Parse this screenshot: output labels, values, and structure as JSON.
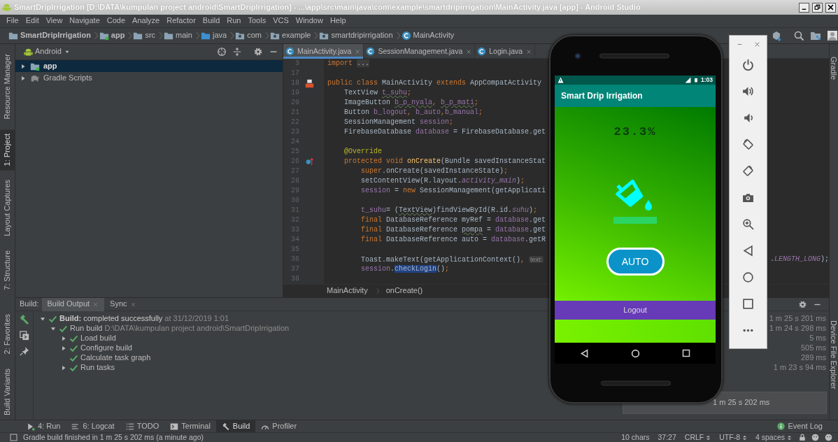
{
  "window": {
    "title": "SmartDripIrrigation [D:\\DATA\\kumpulan project android\\SmartDripIrrigation] - ...\\app\\src\\main\\java\\com\\example\\smartdripirrigation\\MainActivity.java [app] - Android Studio"
  },
  "menu": [
    "File",
    "Edit",
    "View",
    "Navigate",
    "Code",
    "Analyze",
    "Refactor",
    "Build",
    "Run",
    "Tools",
    "VCS",
    "Window",
    "Help"
  ],
  "breadcrumb": [
    {
      "label": "SmartDripIrrigation",
      "kind": "project"
    },
    {
      "label": "app",
      "kind": "module"
    },
    {
      "label": "src",
      "kind": "folder"
    },
    {
      "label": "main",
      "kind": "folder"
    },
    {
      "label": "java",
      "kind": "source"
    },
    {
      "label": "com",
      "kind": "package"
    },
    {
      "label": "example",
      "kind": "package"
    },
    {
      "label": "smartdripirrigation",
      "kind": "package"
    },
    {
      "label": "MainActivity",
      "kind": "class"
    }
  ],
  "left_stripe": {
    "top": [
      {
        "label": "Resource Manager",
        "selected": false
      },
      {
        "label": "1: Project",
        "selected": true
      },
      {
        "label": "Layout Captures",
        "selected": false
      },
      {
        "label": "7: Structure",
        "selected": false
      }
    ],
    "bottom": [
      {
        "label": "2: Favorites",
        "selected": false
      },
      {
        "label": "Build Variants",
        "selected": false
      }
    ]
  },
  "right_stripe": {
    "top": [
      "Gradle"
    ],
    "bottom": [
      "Device File Explorer"
    ]
  },
  "project_panel": {
    "view": "Android",
    "tree": [
      {
        "label": "app",
        "kind": "module",
        "selected": true
      },
      {
        "label": "Gradle Scripts",
        "kind": "gradle",
        "selected": false
      }
    ]
  },
  "editor_tabs": [
    {
      "label": "MainActivity.java",
      "selected": true
    },
    {
      "label": "SessionManagement.java",
      "selected": false
    },
    {
      "label": "Login.java",
      "selected": false
    }
  ],
  "code_lines": [
    {
      "number": "3",
      "segments": [
        {
          "text": "import ",
          "kind": "keyword"
        },
        {
          "text": "...",
          "kind": "folded"
        }
      ]
    },
    {
      "number": "17"
    },
    {
      "number": "18",
      "gutter_icon": {
        "kind": "layout"
      },
      "segments": [
        {
          "text": "public class ",
          "kind": "keyword"
        },
        {
          "text": "MainActivity ",
          "kind": "plain"
        },
        {
          "text": "extends ",
          "kind": "keyword"
        },
        {
          "text": "AppCompatActivity",
          "kind": "plain"
        }
      ]
    },
    {
      "number": "19",
      "segments": [
        {
          "text": "    TextView ",
          "kind": "plain"
        },
        {
          "text": "t_suhu",
          "kind": "field_typo"
        },
        {
          "text": ";",
          "kind": "keyword"
        }
      ]
    },
    {
      "number": "20",
      "segments": [
        {
          "text": "    ImageButton ",
          "kind": "plain"
        },
        {
          "text": "b_p_nyala",
          "kind": "field_typo"
        },
        {
          "text": ", ",
          "kind": "keyword"
        },
        {
          "text": "b_p_mati",
          "kind": "field_typo"
        },
        {
          "text": ";",
          "kind": "keyword"
        }
      ]
    },
    {
      "number": "21",
      "segments": [
        {
          "text": "    Button ",
          "kind": "plain"
        },
        {
          "text": "b_logout",
          "kind": "field"
        },
        {
          "text": ", ",
          "kind": "keyword"
        },
        {
          "text": "b_auto",
          "kind": "field"
        },
        {
          "text": ",",
          "kind": "keyword"
        },
        {
          "text": "b_manual",
          "kind": "field"
        },
        {
          "text": ";",
          "kind": "keyword"
        }
      ]
    },
    {
      "number": "22",
      "segments": [
        {
          "text": "    SessionManagement ",
          "kind": "plain"
        },
        {
          "text": "session",
          "kind": "field"
        },
        {
          "text": ";",
          "kind": "keyword"
        }
      ]
    },
    {
      "number": "23",
      "segments": [
        {
          "text": "    FirebaseDatabase ",
          "kind": "plain"
        },
        {
          "text": "database",
          "kind": "field"
        },
        {
          "text": " = FirebaseDatabase.get",
          "kind": "plain"
        }
      ]
    },
    {
      "number": "24"
    },
    {
      "number": "25",
      "segments": [
        {
          "text": "    @Override",
          "kind": "annotation"
        }
      ]
    },
    {
      "number": "26",
      "gutter_icon": {
        "kind": "override"
      },
      "segments": [
        {
          "text": "    protected void ",
          "kind": "keyword"
        },
        {
          "text": "onCreate",
          "kind": "method"
        },
        {
          "text": "(Bundle savedInstanceStat",
          "kind": "plain"
        }
      ]
    },
    {
      "number": "27",
      "segments": [
        {
          "text": "        super",
          "kind": "keyword"
        },
        {
          "text": ".onCreate(savedInstanceState)",
          "kind": "plain"
        },
        {
          "text": ";",
          "kind": "keyword"
        }
      ]
    },
    {
      "number": "28",
      "segments": [
        {
          "text": "        setContentView(R.layout.",
          "kind": "plain"
        },
        {
          "text": "activity_main",
          "kind": "static"
        },
        {
          "text": ")",
          "kind": "plain"
        },
        {
          "text": ";",
          "kind": "keyword"
        }
      ]
    },
    {
      "number": "29",
      "segments": [
        {
          "text": "        session",
          "kind": "field"
        },
        {
          "text": " = ",
          "kind": "plain"
        },
        {
          "text": "new ",
          "kind": "keyword"
        },
        {
          "text": "SessionManagement(getApplicati",
          "kind": "plain"
        }
      ]
    },
    {
      "number": "30"
    },
    {
      "number": "31",
      "segments": [
        {
          "text": "        t_suhu",
          "kind": "field"
        },
        {
          "text": "= (",
          "kind": "plain"
        },
        {
          "text": "TextView",
          "kind": "plain_typo"
        },
        {
          "text": ")findViewById(R.id.",
          "kind": "plain"
        },
        {
          "text": "suhu",
          "kind": "static"
        },
        {
          "text": ")",
          "kind": "plain"
        },
        {
          "text": ";",
          "kind": "keyword"
        }
      ]
    },
    {
      "number": "32",
      "segments": [
        {
          "text": "        final ",
          "kind": "keyword"
        },
        {
          "text": "DatabaseReference myRef = ",
          "kind": "plain"
        },
        {
          "text": "database",
          "kind": "field"
        },
        {
          "text": ".get",
          "kind": "plain"
        }
      ]
    },
    {
      "number": "33",
      "segments": [
        {
          "text": "        final ",
          "kind": "keyword"
        },
        {
          "text": "DatabaseReference ",
          "kind": "plain"
        },
        {
          "text": "pompa",
          "kind": "plain_typo"
        },
        {
          "text": " = ",
          "kind": "plain"
        },
        {
          "text": "database",
          "kind": "field"
        },
        {
          "text": ".get",
          "kind": "plain"
        }
      ]
    },
    {
      "number": "34",
      "segments": [
        {
          "text": "        final ",
          "kind": "keyword"
        },
        {
          "text": "DatabaseReference auto = ",
          "kind": "plain"
        },
        {
          "text": "database",
          "kind": "field"
        },
        {
          "text": ".getR",
          "kind": "plain"
        }
      ]
    },
    {
      "number": "35"
    },
    {
      "number": "36",
      "segments": [
        {
          "text": "        Toast.makeText(getApplicationContext()",
          "kind": "plain"
        },
        {
          "text": ", ",
          "kind": "keyword"
        },
        {
          "text": "text:",
          "kind": "hint"
        }
      ],
      "tail": [
        {
          "text": ".",
          "kind": "plain"
        },
        {
          "text": "LENGTH_LONG",
          "kind": "static"
        },
        {
          "text": ");",
          "kind": "plain"
        }
      ]
    },
    {
      "number": "37",
      "segments": [
        {
          "text": "        session",
          "kind": "field"
        },
        {
          "text": ".",
          "kind": "plain"
        },
        {
          "text": "checkLogin",
          "kind": "highlight"
        },
        {
          "text": "()",
          "kind": "plain"
        },
        {
          "text": ";",
          "kind": "keyword"
        }
      ]
    },
    {
      "number": "38"
    }
  ],
  "editor_breadcrumb": [
    "MainActivity",
    "onCreate()"
  ],
  "build_panel": {
    "title": "Build:",
    "tabs": [
      {
        "label": "Build Output",
        "selected": true
      },
      {
        "label": "Sync",
        "selected": false
      }
    ],
    "tree": [
      {
        "label": "Build:",
        "text": "completed successfully",
        "note": "at 31/12/2019 1:01",
        "duration": "1 m 25 s 201 ms",
        "kind": "group",
        "expanded": true,
        "children": [
          {
            "label": "Run build",
            "note": "D:\\DATA\\kumpulan project android\\SmartDripIrrigation",
            "duration": "1 m 24 s 298 ms",
            "kind": "group",
            "expanded": true,
            "children": [
              {
                "label": "Load build",
                "duration": "5 ms",
                "kind": "group",
                "expanded": false
              },
              {
                "label": "Configure build",
                "duration": "505 ms",
                "kind": "group",
                "expanded": false
              },
              {
                "label": "Calculate task graph",
                "duration": "289 ms",
                "kind": "leaf"
              },
              {
                "label": "Run tasks",
                "duration": "1 m 23 s 94 ms",
                "kind": "group",
                "expanded": false
              }
            ]
          }
        ]
      }
    ]
  },
  "notification": {
    "text": "1 m 25 s 202 ms"
  },
  "emulator": {
    "status_time": "1:03",
    "app_title": "Smart Drip Irrigation",
    "reading": "23.3%",
    "mode_button": "AUTO",
    "logout_button": "Logout"
  },
  "tool_windows": [
    {
      "label": "4: Run",
      "kind": "run",
      "selected": false
    },
    {
      "label": "6: Logcat",
      "kind": "logcat",
      "selected": false
    },
    {
      "label": "TODO",
      "kind": "todo",
      "selected": false
    },
    {
      "label": "Terminal",
      "kind": "terminal",
      "selected": false
    },
    {
      "label": "Build",
      "kind": "build",
      "selected": true
    },
    {
      "label": "Profiler",
      "kind": "profiler",
      "selected": false
    }
  ],
  "event_log": "Event Log",
  "status_bar": {
    "message": "Gradle build finished in 1 m 25 s 202 ms (a minute ago)",
    "items": [
      {
        "label": "10 chars",
        "dropdown": false
      },
      {
        "label": "37:27",
        "dropdown": false
      },
      {
        "label": "CRLF",
        "dropdown": true
      },
      {
        "label": "UTF-8",
        "dropdown": true
      },
      {
        "label": "4 spaces",
        "dropdown": true
      }
    ]
  }
}
